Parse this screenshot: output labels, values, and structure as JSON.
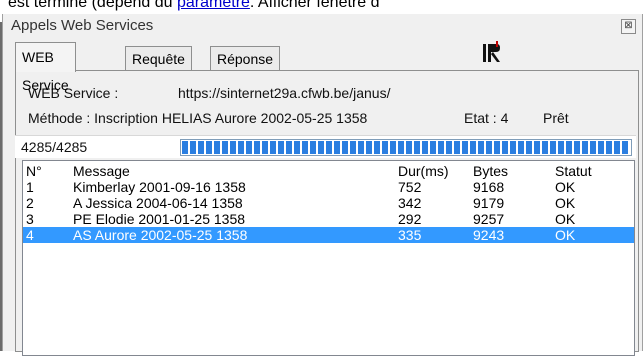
{
  "doc_header": {
    "text_before": "est terminé (dépend du ",
    "link": "paramètre",
    "text_after": ". Afficher fenêtre d"
  },
  "window": {
    "title": "Appels Web Services",
    "close_label": "⊠"
  },
  "tabs": [
    {
      "label": "WEB Service",
      "active": true
    },
    {
      "label": "Requête",
      "active": false
    },
    {
      "label": "Réponse",
      "active": false
    }
  ],
  "service": {
    "label": "WEB Service :",
    "url": "https://sinternet29a.cfwb.be/janus/",
    "method_text": "Méthode : Inscription HELIAS Aurore 2002-05-25 1358",
    "etat_text": "Etat : 4",
    "status_text": "Prêt"
  },
  "progress": {
    "text": "4285/4285",
    "fraction": 1.0
  },
  "table": {
    "headers": [
      "N°",
      "Message",
      "Dur(ms)",
      "Bytes",
      "Statut"
    ],
    "rows": [
      {
        "num": "1",
        "message": "Kimberlay 2001-09-16 1358",
        "dur": "752",
        "bytes": "9168",
        "status": "OK",
        "selected": false
      },
      {
        "num": "2",
        "message": "A Jessica 2004-06-14 1358",
        "dur": "342",
        "bytes": "9179",
        "status": "OK",
        "selected": false
      },
      {
        "num": "3",
        "message": "PE Elodie 2001-01-25 1358",
        "dur": "292",
        "bytes": "9257",
        "status": "OK",
        "selected": false
      },
      {
        "num": "4",
        "message": "AS Aurore 2002-05-25 1358",
        "dur": "335",
        "bytes": "9243",
        "status": "OK",
        "selected": true
      }
    ]
  },
  "colors": {
    "selection": "#3399ff",
    "progress": "#2a7ee0",
    "link": "#0000cc"
  }
}
